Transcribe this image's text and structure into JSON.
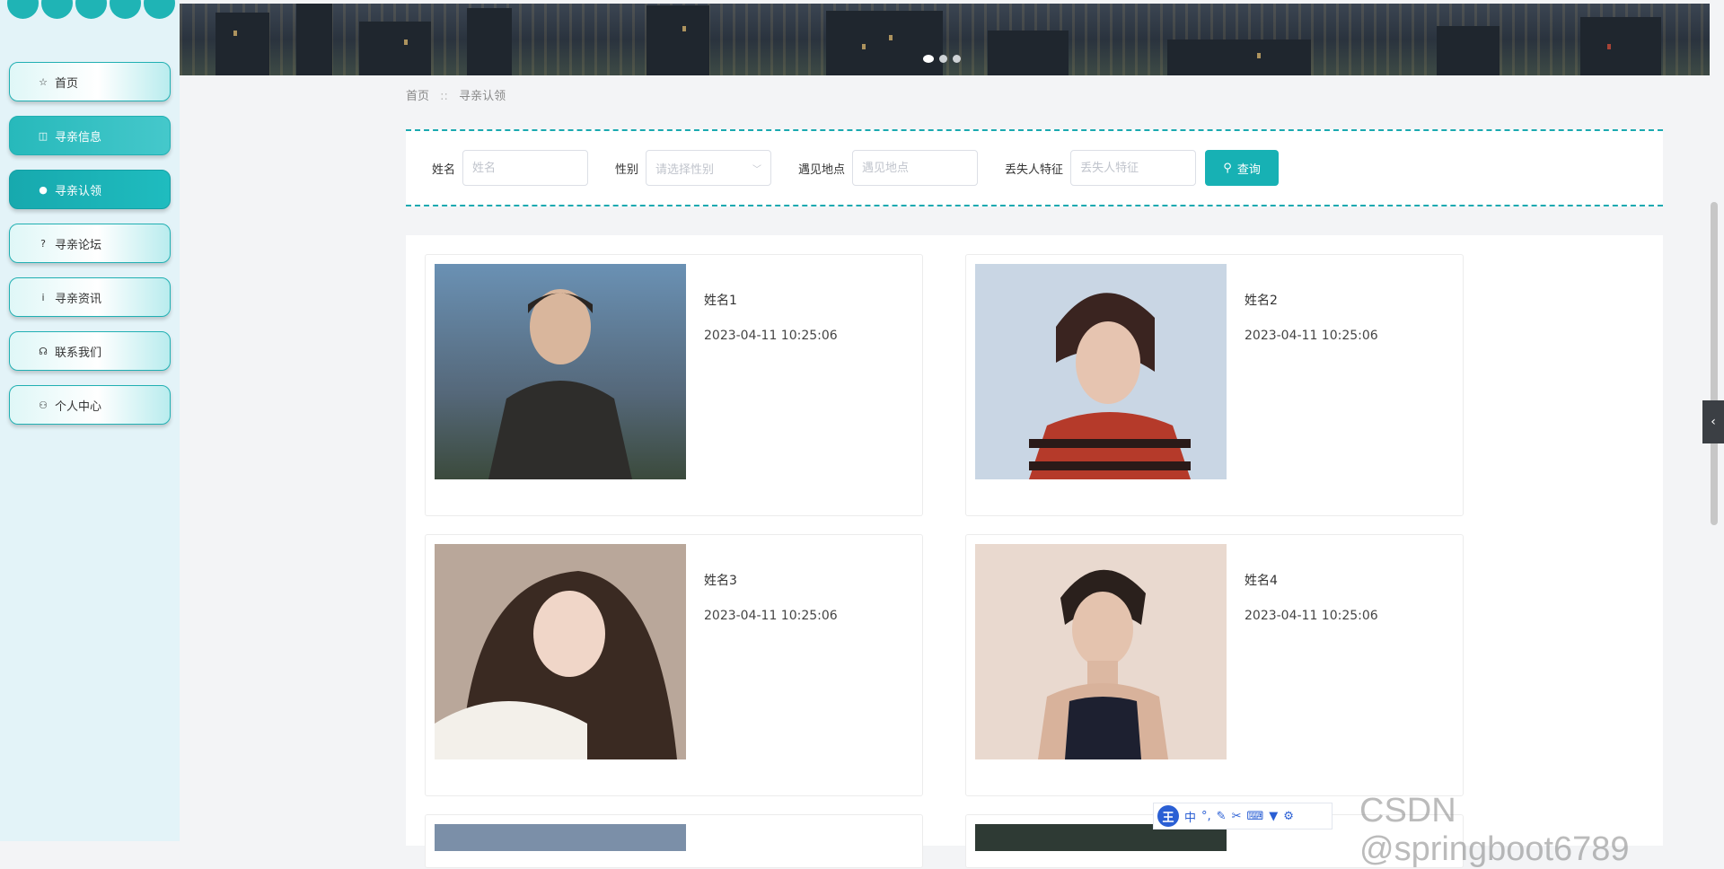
{
  "sidebar": {
    "items": [
      {
        "label": "首页",
        "icon": "star-icon",
        "glyph": "☆",
        "state": "normal"
      },
      {
        "label": "寻亲信息",
        "icon": "bag-icon",
        "glyph": "◫",
        "state": "hover"
      },
      {
        "label": "寻亲认领",
        "icon": "info-icon",
        "glyph": "●",
        "state": "active"
      },
      {
        "label": "寻亲论坛",
        "icon": "question-icon",
        "glyph": "?",
        "state": "normal"
      },
      {
        "label": "寻亲资讯",
        "icon": "info-circle-icon",
        "glyph": "i",
        "state": "normal"
      },
      {
        "label": "联系我们",
        "icon": "headset-icon",
        "glyph": "☊",
        "state": "normal"
      },
      {
        "label": "个人中心",
        "icon": "user-icon",
        "glyph": "⚇",
        "state": "normal"
      }
    ]
  },
  "breadcrumb": {
    "home": "首页",
    "separator": "::",
    "current": "寻亲认领"
  },
  "search": {
    "name_label": "姓名",
    "name_placeholder": "姓名",
    "gender_label": "性别",
    "gender_placeholder": "请选择性别",
    "location_label": "遇见地点",
    "location_placeholder": "遇见地点",
    "feature_label": "丢失人特征",
    "feature_placeholder": "丢失人特征",
    "button_label": "查询"
  },
  "cards": [
    {
      "name": "姓名1",
      "date": "2023-04-11 10:25:06"
    },
    {
      "name": "姓名2",
      "date": "2023-04-11 10:25:06"
    },
    {
      "name": "姓名3",
      "date": "2023-04-11 10:25:06"
    },
    {
      "name": "姓名4",
      "date": "2023-04-11 10:25:06"
    }
  ],
  "ime": {
    "logo": "王",
    "mode": "中",
    "punct": "°,"
  },
  "watermark": "CSDN @springboot6789",
  "colors": {
    "accent": "#17b1b4",
    "sidebar_bg": "#e3f3f8"
  }
}
